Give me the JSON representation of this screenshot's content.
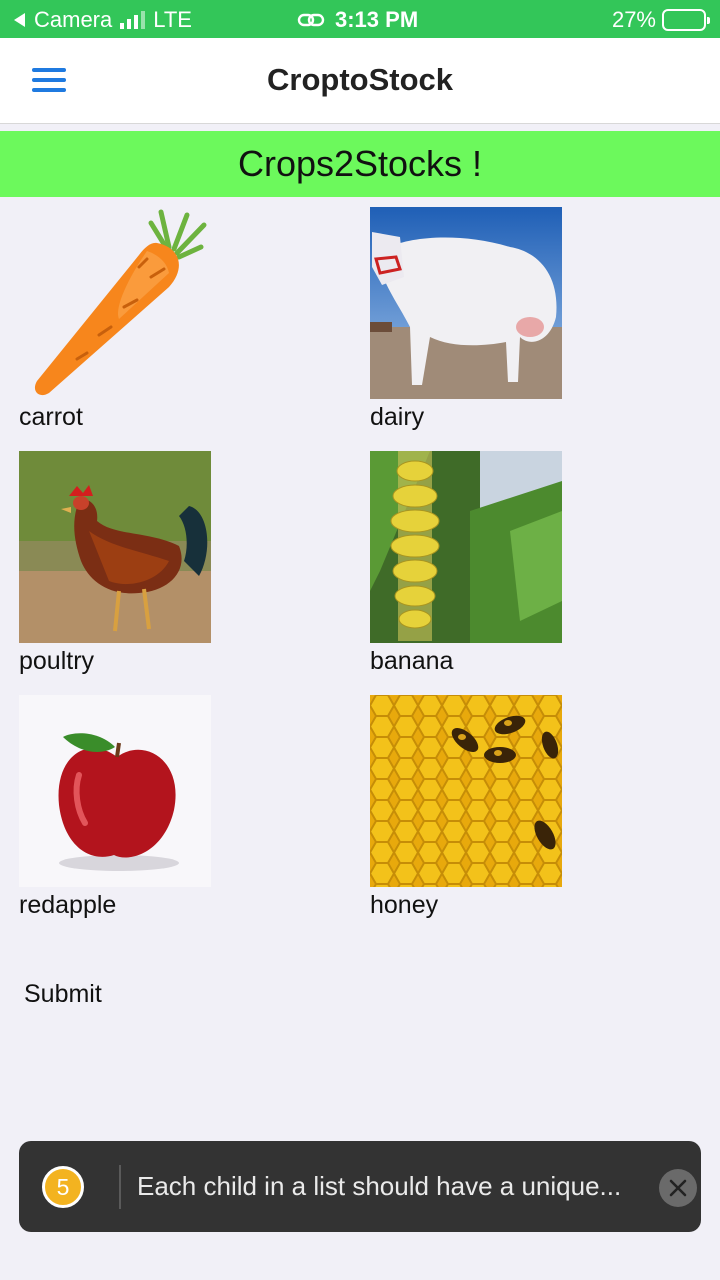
{
  "status_bar": {
    "back_app": "Camera",
    "network": "LTE",
    "time": "3:13 PM",
    "battery": "27%",
    "battery_level": 0.27
  },
  "header": {
    "title": "CroptoStock"
  },
  "banner": {
    "text": "Crops2Stocks !"
  },
  "items": [
    {
      "label": "carrot"
    },
    {
      "label": "dairy"
    },
    {
      "label": "poultry"
    },
    {
      "label": "banana"
    },
    {
      "label": "redapple"
    },
    {
      "label": "honey"
    }
  ],
  "submit": {
    "label": "Submit"
  },
  "toast": {
    "count": "5",
    "message": "Each child in a list should have a unique..."
  },
  "colors": {
    "status_bar": "#33c659",
    "banner": "#6cf95c",
    "menu_icon": "#1f7ae0",
    "toast_bg": "#333333",
    "toast_badge": "#f3b320"
  }
}
